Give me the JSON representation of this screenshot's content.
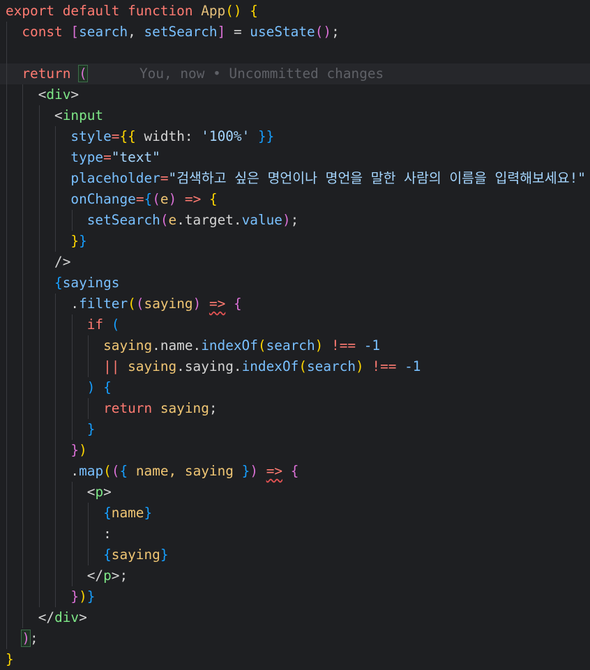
{
  "editor": {
    "blame": "You, now • Uncommitted changes",
    "lines": [
      {
        "indent": 0,
        "tokens": [
          [
            "export default function ",
            "kw"
          ],
          [
            "App",
            "fn"
          ],
          [
            "() ",
            "br1"
          ],
          [
            "{",
            "br1"
          ]
        ]
      },
      {
        "indent": 1,
        "tokens": [
          [
            "const ",
            "kw"
          ],
          [
            "[",
            "br2"
          ],
          [
            "search",
            "var"
          ],
          [
            ", ",
            "plain"
          ],
          [
            "setSearch",
            "var"
          ],
          [
            "]",
            "br2"
          ],
          [
            " = ",
            "plain"
          ],
          [
            "useState",
            "fn2"
          ],
          [
            "()",
            "br2"
          ],
          [
            ";",
            "plain"
          ]
        ]
      },
      {
        "indent": 1,
        "tokens": []
      },
      {
        "indent": 1,
        "current": true,
        "blame": true,
        "tokens": [
          [
            "return ",
            "kw"
          ],
          [
            "(",
            "br2box"
          ]
        ]
      },
      {
        "indent": 2,
        "tokens": [
          [
            "<",
            "tagp"
          ],
          [
            "div",
            "tag"
          ],
          [
            ">",
            "tagp"
          ]
        ]
      },
      {
        "indent": 3,
        "tokens": [
          [
            "<",
            "tagp"
          ],
          [
            "input",
            "tag"
          ]
        ]
      },
      {
        "indent": 4,
        "tokens": [
          [
            "style",
            "attr"
          ],
          [
            "=",
            "plain2"
          ],
          [
            "{{",
            "br1"
          ],
          [
            " width: ",
            "plain"
          ],
          [
            "'100%'",
            "str"
          ],
          [
            " }}",
            "br3"
          ]
        ]
      },
      {
        "indent": 4,
        "tokens": [
          [
            "type",
            "attr"
          ],
          [
            "=",
            "plain2"
          ],
          [
            "\"text\"",
            "str"
          ]
        ]
      },
      {
        "indent": 4,
        "tokens": [
          [
            "placeholder",
            "attr"
          ],
          [
            "=",
            "plain2"
          ],
          [
            "\"검색하고 싶은 명언이나 명언을 말한 사람의 이름을 입력해보세요!\"",
            "str"
          ]
        ]
      },
      {
        "indent": 4,
        "tokens": [
          [
            "onChange",
            "attr"
          ],
          [
            "=",
            "plain2"
          ],
          [
            "{",
            "br3"
          ],
          [
            "(",
            "br2"
          ],
          [
            "e",
            "param"
          ],
          [
            ")",
            "br2"
          ],
          [
            " => ",
            "kw2"
          ],
          [
            "{",
            "br1"
          ]
        ]
      },
      {
        "indent": 5,
        "tokens": [
          [
            "setSearch",
            "fn2"
          ],
          [
            "(",
            "br2"
          ],
          [
            "e",
            "param"
          ],
          [
            ".target.",
            "plain"
          ],
          [
            "value",
            "prop"
          ],
          [
            ")",
            "br2"
          ],
          [
            ";",
            "plain"
          ]
        ]
      },
      {
        "indent": 4,
        "tokens": [
          [
            "}",
            "br1"
          ],
          [
            "}",
            "br3"
          ]
        ]
      },
      {
        "indent": 3,
        "tokens": [
          [
            "/>",
            "tagp"
          ]
        ]
      },
      {
        "indent": 3,
        "tokens": [
          [
            "{",
            "br3"
          ],
          [
            "sayings",
            "var"
          ]
        ]
      },
      {
        "indent": 4,
        "tokens": [
          [
            ".",
            "plain"
          ],
          [
            "filter",
            "fn2"
          ],
          [
            "(",
            "br1"
          ],
          [
            "(",
            "br2"
          ],
          [
            "saying",
            "param"
          ],
          [
            ")",
            "br2"
          ],
          [
            " ",
            "plain"
          ],
          [
            "=>",
            "kw2sq"
          ],
          [
            " ",
            "plain"
          ],
          [
            "{",
            "br2"
          ]
        ]
      },
      {
        "indent": 5,
        "tokens": [
          [
            "if ",
            "kw"
          ],
          [
            "(",
            "br3"
          ]
        ]
      },
      {
        "indent": 6,
        "tokens": [
          [
            "saying",
            "param"
          ],
          [
            ".name.",
            "plain"
          ],
          [
            "indexOf",
            "fn2"
          ],
          [
            "(",
            "br1"
          ],
          [
            "search",
            "var"
          ],
          [
            ")",
            "br1"
          ],
          [
            " !== ",
            "kw2"
          ],
          [
            "-1",
            "num"
          ]
        ]
      },
      {
        "indent": 6,
        "tokens": [
          [
            "|| ",
            "kw2"
          ],
          [
            "saying",
            "param"
          ],
          [
            ".saying.",
            "plain"
          ],
          [
            "indexOf",
            "fn2"
          ],
          [
            "(",
            "br1"
          ],
          [
            "search",
            "var"
          ],
          [
            ")",
            "br1"
          ],
          [
            " !== ",
            "kw2"
          ],
          [
            "-1",
            "num"
          ]
        ]
      },
      {
        "indent": 5,
        "tokens": [
          [
            ")",
            "br3"
          ],
          [
            " ",
            "plain"
          ],
          [
            "{",
            "br3"
          ]
        ]
      },
      {
        "indent": 6,
        "tokens": [
          [
            "return ",
            "kw"
          ],
          [
            "saying",
            "param"
          ],
          [
            ";",
            "plain"
          ]
        ]
      },
      {
        "indent": 5,
        "tokens": [
          [
            "}",
            "br3"
          ]
        ]
      },
      {
        "indent": 4,
        "tokens": [
          [
            "}",
            "br2"
          ],
          [
            ")",
            "br1"
          ]
        ]
      },
      {
        "indent": 4,
        "tokens": [
          [
            ".",
            "plain"
          ],
          [
            "map",
            "fn2"
          ],
          [
            "(",
            "br1"
          ],
          [
            "(",
            "br2"
          ],
          [
            "{",
            "br3"
          ],
          [
            " name, saying ",
            "param"
          ],
          [
            "}",
            "br3"
          ],
          [
            ")",
            "br2"
          ],
          [
            " ",
            "plain"
          ],
          [
            "=>",
            "kw2sq"
          ],
          [
            " ",
            "plain"
          ],
          [
            "{",
            "br2"
          ]
        ]
      },
      {
        "indent": 5,
        "tokens": [
          [
            "<",
            "tagp"
          ],
          [
            "p",
            "tag"
          ],
          [
            ">",
            "tagp"
          ]
        ]
      },
      {
        "indent": 6,
        "tokens": [
          [
            "{",
            "br3"
          ],
          [
            "name",
            "param"
          ],
          [
            "}",
            "br3"
          ]
        ]
      },
      {
        "indent": 6,
        "tokens": [
          [
            ":",
            "plain"
          ]
        ]
      },
      {
        "indent": 6,
        "tokens": [
          [
            "{",
            "br3"
          ],
          [
            "saying",
            "param"
          ],
          [
            "}",
            "br3"
          ]
        ]
      },
      {
        "indent": 5,
        "tokens": [
          [
            "</",
            "tagp"
          ],
          [
            "p",
            "tag"
          ],
          [
            ">",
            "tagp"
          ],
          [
            ";",
            "plain"
          ]
        ]
      },
      {
        "indent": 4,
        "tokens": [
          [
            "}",
            "br2"
          ],
          [
            ")",
            "br1"
          ],
          [
            "}",
            "br3"
          ]
        ]
      },
      {
        "indent": 2,
        "tokens": [
          [
            "</",
            "tagp"
          ],
          [
            "div",
            "tag"
          ],
          [
            ">",
            "tagp"
          ]
        ]
      },
      {
        "indent": 1,
        "tokens": [
          [
            ")",
            "br2box"
          ],
          [
            ";",
            "plain"
          ]
        ]
      },
      {
        "indent": 0,
        "tokens": [
          [
            "}",
            "br1"
          ]
        ]
      }
    ]
  },
  "colors": {
    "kw": "#ff7b72",
    "kw2": "#ff7b72",
    "kw2sq": "#ff7b72",
    "fn": "#e5c07b",
    "fn2": "#79c0ff",
    "var": "#79c0ff",
    "param": "#f0c674",
    "prop": "#79c0ff",
    "attr": "#79c0ff",
    "str": "#a5d6ff",
    "num": "#79c0ff",
    "tag": "#7ee787",
    "tagp": "#d4d4d4",
    "plain": "#d4d4d4",
    "plain2": "#ff7b72",
    "br1": "#ffd700",
    "br2": "#da70d6",
    "br2box": "#da70d6",
    "br3": "#179fff"
  }
}
